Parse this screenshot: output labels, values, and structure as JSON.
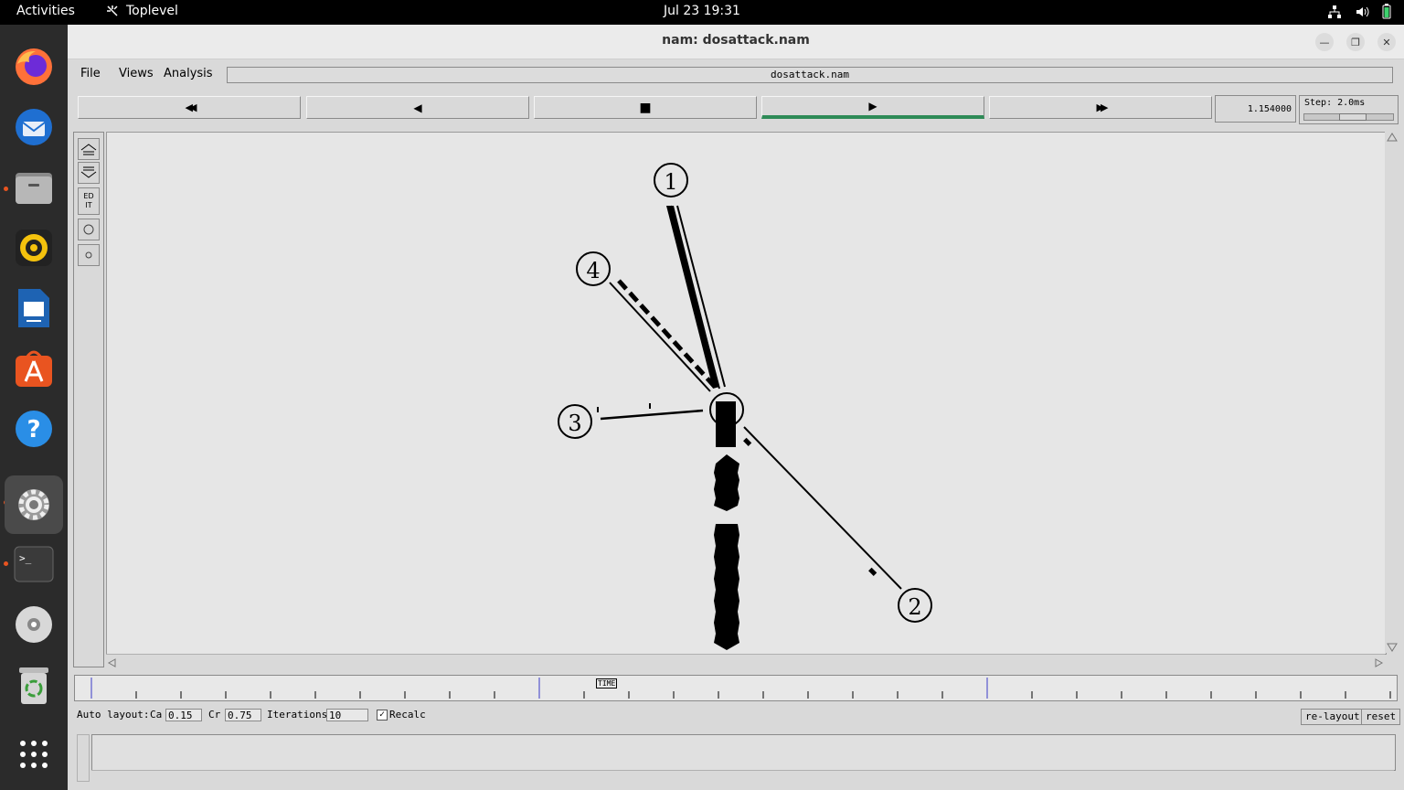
{
  "topbar": {
    "activities": "Activities",
    "app_name": "Toplevel",
    "clock": "Jul 23  19:31"
  },
  "dock": {
    "items": [
      "firefox-icon",
      "thunderbird-icon",
      "files-icon",
      "rhythmbox-icon",
      "writer-icon",
      "app-center-icon",
      "help-icon",
      "settings-icon",
      "terminal-icon",
      "dvd-icon",
      "trash-icon",
      "app-grid-icon"
    ]
  },
  "window": {
    "title": "nam: dosattack.nam",
    "menus": [
      {
        "label": "File",
        "accel": "F"
      },
      {
        "label": "Views",
        "accel": "V"
      },
      {
        "label": "Analysis",
        "accel": "A"
      }
    ],
    "filename": "dosattack.nam"
  },
  "controls": {
    "rewind": "◀◀",
    "back": "◀",
    "stop": "■",
    "play": "▶",
    "fastforward": "▶▶",
    "time": "1.154000",
    "step_label": "Step: 2.0ms",
    "step_fraction": 0.55
  },
  "tools": {
    "edit_label_top": "ED",
    "edit_label_bottom": "IT"
  },
  "network": {
    "nodes": [
      {
        "id": "0",
        "label": ""
      },
      {
        "id": "1",
        "label": "1"
      },
      {
        "id": "2",
        "label": "2"
      },
      {
        "id": "3",
        "label": "3"
      },
      {
        "id": "4",
        "label": "4"
      }
    ]
  },
  "timeline": {
    "label": "TIME"
  },
  "autolayout": {
    "label": "Auto layout:",
    "ca_label": "Ca",
    "ca_value": "0.15",
    "cr_label": "Cr",
    "cr_value": "0.75",
    "iterations_label": "Iterations",
    "iterations_value": "10",
    "recalc_label": "Recalc",
    "recalc_checked": true,
    "relayout_button": "re-layout",
    "reset_button": "reset"
  }
}
